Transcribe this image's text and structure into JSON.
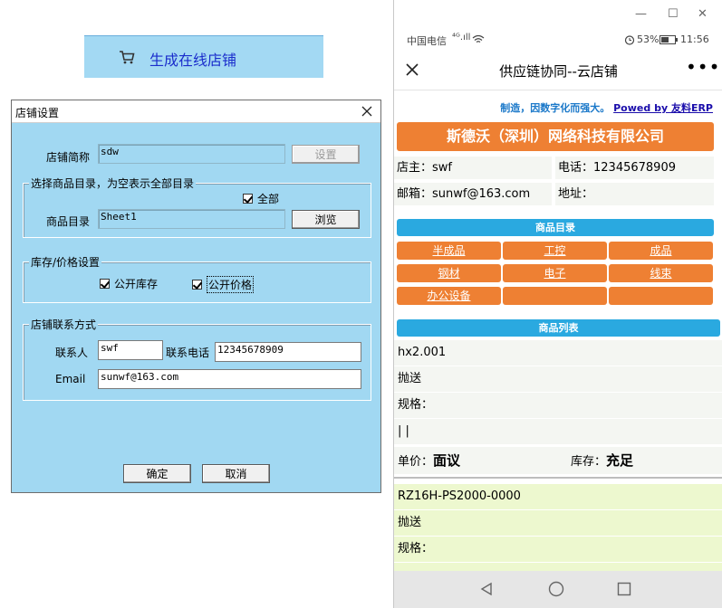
{
  "generate_button": {
    "label": "生成在线店铺",
    "icon": "cart-icon"
  },
  "dialog": {
    "title": "店铺设置",
    "shop_name_label": "店铺简称",
    "shop_name_value": "sdw",
    "set_button": "设置",
    "catalog_group_title": "选择商品目录，为空表示全部目录",
    "all_checkbox": "全部",
    "catalog_label": "商品目录",
    "catalog_value": "Sheet1",
    "browse_button": "浏览",
    "stock_group_title": "库存/价格设置",
    "public_stock": "公开库存",
    "public_price": "公开价格",
    "contact_group_title": "店铺联系方式",
    "contact_label": "联系人",
    "contact_value": "swf",
    "phone_label": "联系电话",
    "phone_value": "12345678909",
    "email_label": "Email",
    "email_value": "sunwf@163.com",
    "ok_button": "确定",
    "cancel_button": "取消"
  },
  "phone": {
    "window_controls": [
      "—",
      "☐",
      "✕"
    ],
    "status": {
      "carrier": "中国电信",
      "signal": "⁴ᴳ.ıll",
      "battery": "53%",
      "time": "11:56"
    },
    "nav_title": "供应链协同--云店铺",
    "slogan_text": "制造，因数字化而强大。",
    "slogan_link": "Powed by 友料ERP",
    "company": "斯德沃（深圳）网络科技有限公司",
    "owner": "店主：swf",
    "tel": "电话：12345678909",
    "email": "邮箱：sunwf@163.com",
    "address": "地址：",
    "catalog_title": "商品目录",
    "categories": [
      "半成品",
      "工控",
      "成品",
      "钢材",
      "电子",
      "线束",
      "办公设备",
      "",
      ""
    ],
    "list_title": "商品列表",
    "product1": {
      "name": "hx2.001",
      "l1": "抛送",
      "l2": "规格：",
      "l3": "| |",
      "price_label": "单价：",
      "price": "面议",
      "stock_label": "库存：",
      "stock": "充足"
    },
    "product2": {
      "name": "RZ16H-PS2000-0000",
      "l1": "抛送",
      "l2": "规格："
    },
    "colors": {
      "orange": "#ee8033",
      "blue": "#2aa9e0",
      "dialog_bg": "#a1d8f2"
    }
  }
}
